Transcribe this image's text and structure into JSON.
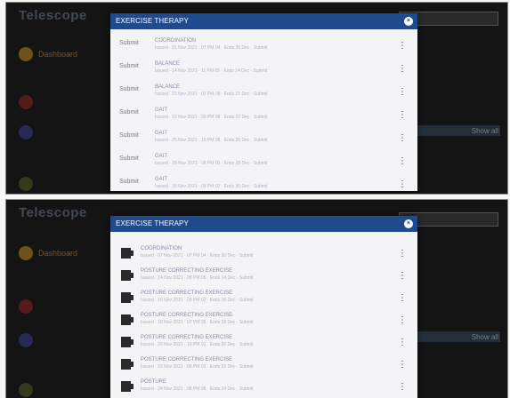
{
  "modal_title": "EXERCISE THERAPY",
  "close_glyph": "×",
  "menu_glyph": "⋮",
  "top_rows": [
    {
      "img_alt": "Submit",
      "title": "COORDINATION",
      "sub": "Issued · 01 Nov 2021 · 07 PM 04 · Ends 30 Dec · Submit"
    },
    {
      "img_alt": "Submit",
      "title": "BALANCE",
      "sub": "Issued · 14 Nov 2021 · 11 PM 05 · Ends 14 Dec · Submit"
    },
    {
      "img_alt": "Submit",
      "title": "BALANCE",
      "sub": "Issued · 21 Nov 2021 · 07 PM 08 · Ends 21 Dec · Submit"
    },
    {
      "img_alt": "Submit",
      "title": "GAIT",
      "sub": "Issued · 22 Nov 2021 · 09 PM 06 · Ends 22 Dec · Submit"
    },
    {
      "img_alt": "Submit",
      "title": "GAIT",
      "sub": "Issued · 25 Nov 2021 · 10 PM 05 · Ends 25 Dec · Submit"
    },
    {
      "img_alt": "Submit",
      "title": "GAIT",
      "sub": "Issued · 28 Nov 2021 · 08 PM 03 · Ends 28 Dec · Submit"
    },
    {
      "img_alt": "Submit",
      "title": "GAIT",
      "sub": "Issued · 30 Nov 2021 · 09 PM 07 · Ends 30 Dec · Submit"
    }
  ],
  "bottom_rows": [
    {
      "title": "COORDINATION",
      "sub": "Issued · 07 Nov 2021 · 07 PM 04 · Ends 30 Dec · Submit"
    },
    {
      "title": "POSTURE CORRECTING EXERCISE",
      "sub": "Issued · 14 Nov 2021 · 08 PM 05 · Ends 14 Dec · Submit"
    },
    {
      "title": "POSTURE CORRECTING EXERCISE",
      "sub": "Issued · 16 Nov 2021 · 09 PM 02 · Ends 16 Dec · Submit"
    },
    {
      "title": "POSTURE CORRECTING EXERCISE",
      "sub": "Issued · 18 Nov 2021 · 07 PM 05 · Ends 18 Dec · Submit"
    },
    {
      "title": "POSTURE CORRECTING EXERCISE",
      "sub": "Issued · 20 Nov 2021 · 10 PM 01 · Ends 20 Dec · Submit"
    },
    {
      "title": "POSTURE CORRECTING EXERCISE",
      "sub": "Issued · 22 Nov 2021 · 09 PM 03 · Ends 22 Dec · Submit"
    },
    {
      "title": "POSTURE",
      "sub": "Issued · 24 Nov 2021 · 08 PM 06 · Ends 24 Dec · Submit"
    }
  ],
  "background": {
    "app_name_top": "Telescope",
    "app_name_bottom": "Telescope",
    "sidebar_label": "Dashboard",
    "right_label": "Show all"
  },
  "colors": {
    "header": "#1f4a8e",
    "backdrop": "#141414",
    "modal_body": "#f4f4f7"
  }
}
